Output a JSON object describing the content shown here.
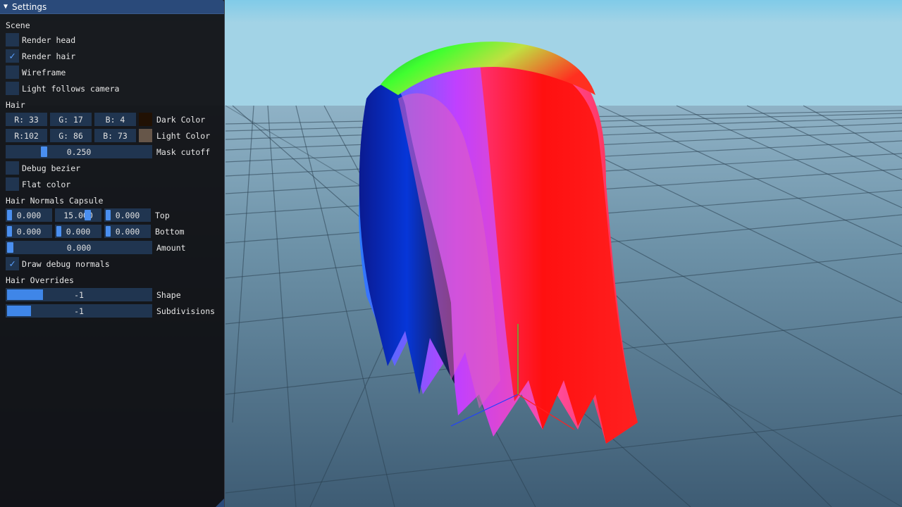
{
  "window": {
    "title": "Settings"
  },
  "scene": {
    "header": "Scene",
    "render_head": {
      "label": "Render head",
      "checked": false
    },
    "render_hair": {
      "label": "Render hair",
      "checked": true
    },
    "wireframe": {
      "label": "Wireframe",
      "checked": false
    },
    "light_follows_camera": {
      "label": "Light follows camera",
      "checked": false
    }
  },
  "hair": {
    "header": "Hair",
    "dark": {
      "r": "R: 33",
      "g": "G: 17",
      "b": "B:  4",
      "label": "Dark Color",
      "swatch": "#211104"
    },
    "light": {
      "r": "R:102",
      "g": "G: 86",
      "b": "B: 73",
      "label": "Light Color",
      "swatch": "#665649"
    },
    "mask_cutoff": {
      "value": "0.250",
      "label": "Mask cutoff"
    },
    "debug_bezier": {
      "label": "Debug bezier",
      "checked": false
    },
    "flat_color": {
      "label": "Flat color",
      "checked": false
    }
  },
  "capsule": {
    "header": "Hair Normals Capsule",
    "top": {
      "v1": "0.000",
      "v2": "15.000",
      "v3": "0.000",
      "label": "Top"
    },
    "bottom": {
      "v1": "0.000",
      "v2": "0.000",
      "v3": "0.000",
      "label": "Bottom"
    },
    "amount": {
      "value": "0.000",
      "label": "Amount"
    },
    "draw_debug_normals": {
      "label": "Draw debug normals",
      "checked": true
    }
  },
  "overrides": {
    "header": "Hair Overrides",
    "shape": {
      "value": "-1",
      "label": "Shape"
    },
    "subdivisions": {
      "value": "-1",
      "label": "Subdivisions"
    }
  },
  "colors": {
    "accent": "#4a8ff0",
    "frame_bg": "#203550",
    "title_bg": "#2a4a7a"
  }
}
